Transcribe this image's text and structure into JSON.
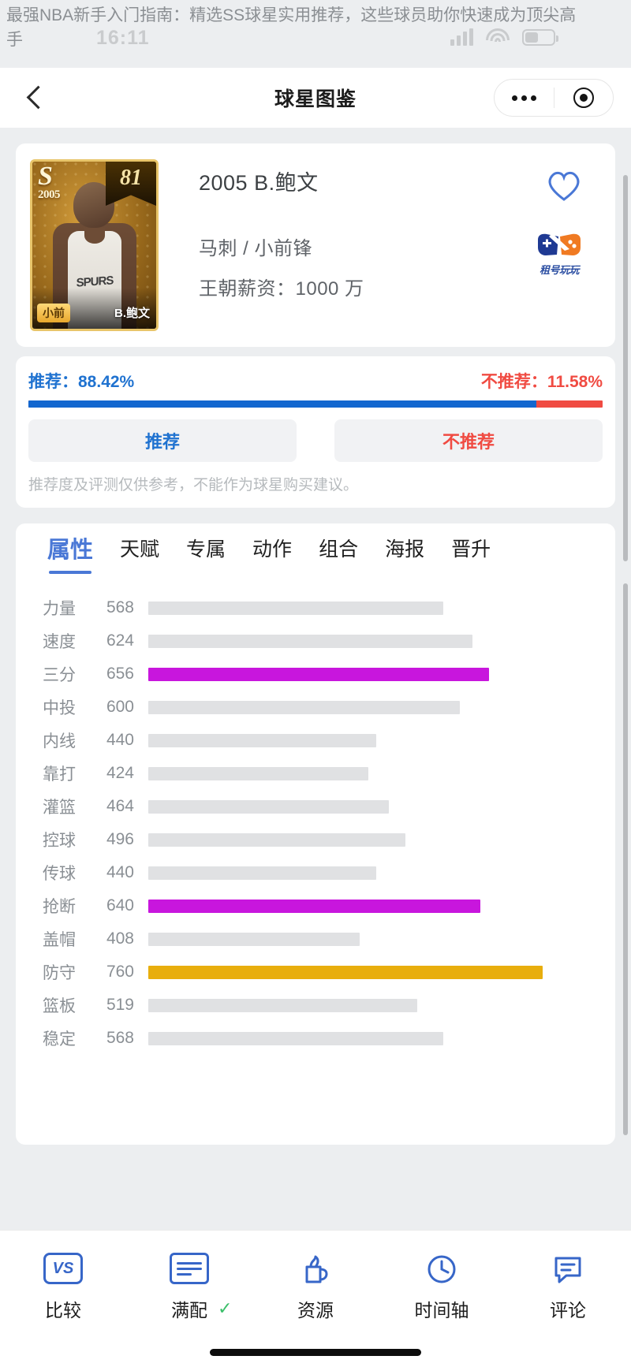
{
  "article": {
    "title": "最强NBA新手入门指南：精选SS球星实用推荐，这些球员助你快速成为顶尖高手"
  },
  "status_bar": {
    "time": "16:11",
    "icons": [
      "signal-icon",
      "wifi-icon",
      "battery-icon"
    ]
  },
  "nav": {
    "back_icon": "back-chevron-icon",
    "title": "球星图鉴",
    "capsule": {
      "more_icon": "more-dots-icon",
      "target_icon": "target-icon"
    }
  },
  "player": {
    "card": {
      "rarity": "S",
      "year": "2005",
      "rating": "81",
      "position_badge": "小前",
      "name_badge": "B.鲍文",
      "jersey_text": "SPURS"
    },
    "name": "2005 B.鲍文",
    "team_position": "马刺 / 小前锋",
    "salary": "王朝薪资：1000 万",
    "favorite_icon": "heart-icon",
    "brand": {
      "icon": "gamepad-icon",
      "label": "租号玩玩"
    }
  },
  "recommend": {
    "yes_label": "推荐：",
    "yes_value": "88.42%",
    "yes_pct": 88.42,
    "no_label": "不推荐：",
    "no_value": "11.58%",
    "no_pct": 11.58,
    "yes_button": "推荐",
    "no_button": "不推荐",
    "note": "推荐度及评测仅供参考，不能作为球星购买建议。",
    "color_yes": "#1267cf",
    "color_no": "#f04b42"
  },
  "tabs": [
    {
      "label": "属性",
      "active": true
    },
    {
      "label": "天赋",
      "active": false
    },
    {
      "label": "专属",
      "active": false
    },
    {
      "label": "动作",
      "active": false
    },
    {
      "label": "组合",
      "active": false
    },
    {
      "label": "海报",
      "active": false
    },
    {
      "label": "晋升",
      "active": false
    }
  ],
  "chart_data": {
    "type": "bar",
    "title": "属性",
    "orientation": "horizontal",
    "categories": [
      "力量",
      "速度",
      "三分",
      "中投",
      "内线",
      "靠打",
      "灌篮",
      "控球",
      "传球",
      "抢断",
      "盖帽",
      "防守",
      "篮板",
      "稳定"
    ],
    "values": [
      568,
      624,
      656,
      600,
      440,
      424,
      464,
      496,
      440,
      640,
      408,
      760,
      519,
      568
    ],
    "xlim": [
      0,
      760
    ],
    "grid": false,
    "legend": null,
    "xlabel": "",
    "ylabel": "",
    "bar_colors": [
      "#e0e1e3",
      "#e0e1e3",
      "#c816dd",
      "#e0e1e3",
      "#e0e1e3",
      "#e0e1e3",
      "#e0e1e3",
      "#e0e1e3",
      "#e0e1e3",
      "#c816dd",
      "#e0e1e3",
      "#e8ae0d",
      "#e0e1e3",
      "#e0e1e3"
    ],
    "highlight_purple": [
      "三分",
      "抢断"
    ],
    "highlight_gold": [
      "防守"
    ]
  },
  "toolbar": [
    {
      "label": "比较",
      "icon": "vs-icon",
      "check": ""
    },
    {
      "label": "满配",
      "icon": "calculator-icon",
      "check": "✓"
    },
    {
      "label": "资源",
      "icon": "resource-icon",
      "check": ""
    },
    {
      "label": "时间轴",
      "icon": "clock-icon",
      "check": ""
    },
    {
      "label": "评论",
      "icon": "comment-icon",
      "check": ""
    }
  ]
}
